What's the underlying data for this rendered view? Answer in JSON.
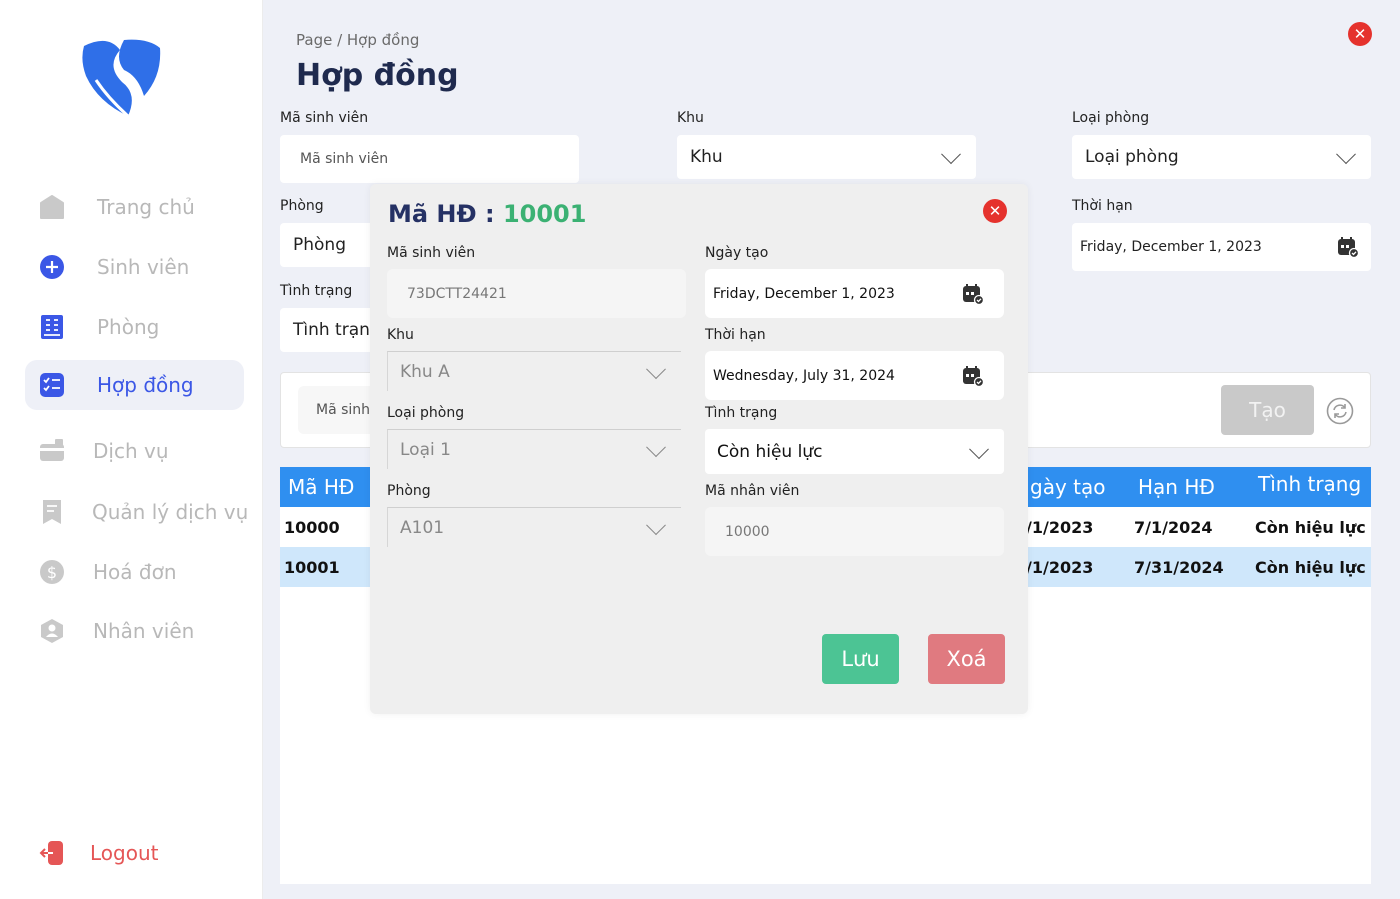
{
  "sidebar": {
    "items": [
      {
        "label": "Trang chủ",
        "icon": "home-icon"
      },
      {
        "label": "Sinh viên",
        "icon": "plus-circle-icon"
      },
      {
        "label": "Phòng",
        "icon": "building-icon"
      },
      {
        "label": "Hợp đồng",
        "icon": "checklist-icon",
        "active": true
      },
      {
        "label": "Dịch vụ",
        "icon": "service-icon"
      },
      {
        "label": "Quản lý dịch vụ",
        "icon": "receipt-icon"
      },
      {
        "label": "Hoá đơn",
        "icon": "dollar-icon"
      },
      {
        "label": "Nhân viên",
        "icon": "person-icon"
      }
    ],
    "logout": "Logout"
  },
  "header": {
    "breadcrumb": "Page / Hợp đồng",
    "title": "Hợp đồng"
  },
  "filters": {
    "ma_sinh_vien": {
      "label": "Mã sinh viên",
      "placeholder": "Mã sinh viên"
    },
    "khu": {
      "label": "Khu",
      "value": "Khu"
    },
    "loai_phong": {
      "label": "Loại phòng",
      "value": "Loại phòng"
    },
    "phong": {
      "label": "Phòng",
      "value": "Phòng"
    },
    "thoi_han": {
      "label": "Thời hạn",
      "value": "Friday, December 1, 2023"
    },
    "tinh_trang": {
      "label": "Tình trạng",
      "value": "Tình trạng"
    }
  },
  "search": {
    "placeholder": "Mã sinh",
    "create_label": "Tạo"
  },
  "table": {
    "headers": {
      "ma_hd": "Mã HĐ",
      "ngay_tao": "gày tạo",
      "han_hd": "Hạn HĐ",
      "tinh_trang": "Tình trạng"
    },
    "rows": [
      {
        "ma_hd": "10000",
        "ngay_tao": "/1/2023",
        "han_hd": "7/1/2024",
        "tinh_trang": "Còn hiệu lực"
      },
      {
        "ma_hd": "10001",
        "ngay_tao": "/1/2023",
        "han_hd": "7/31/2024",
        "tinh_trang": "Còn hiệu lực"
      }
    ]
  },
  "modal": {
    "title_prefix": "Mã HĐ :",
    "contract_id": "10001",
    "ma_sinh_vien": {
      "label": "Mã sinh viên",
      "value": "73DCTT24421"
    },
    "khu": {
      "label": "Khu",
      "value": "Khu A"
    },
    "loai_phong": {
      "label": "Loại phòng",
      "value": "Loại 1"
    },
    "phong": {
      "label": "Phòng",
      "value": "A101"
    },
    "ngay_tao": {
      "label": "Ngày tạo",
      "value": "Friday, December 1, 2023"
    },
    "thoi_han": {
      "label": "Thời hạn",
      "value": "Wednesday, July 31, 2024"
    },
    "tinh_trang": {
      "label": "Tình trạng",
      "value": "Còn hiệu lực"
    },
    "ma_nhan_vien": {
      "label": "Mã nhân viên",
      "value": "10000"
    },
    "save_label": "Lưu",
    "delete_label": "Xoá"
  },
  "colors": {
    "accent": "#3b57e6",
    "table_header": "#2f8ff0",
    "save": "#4cc494",
    "delete": "#e07a80",
    "close": "#e5322d"
  }
}
